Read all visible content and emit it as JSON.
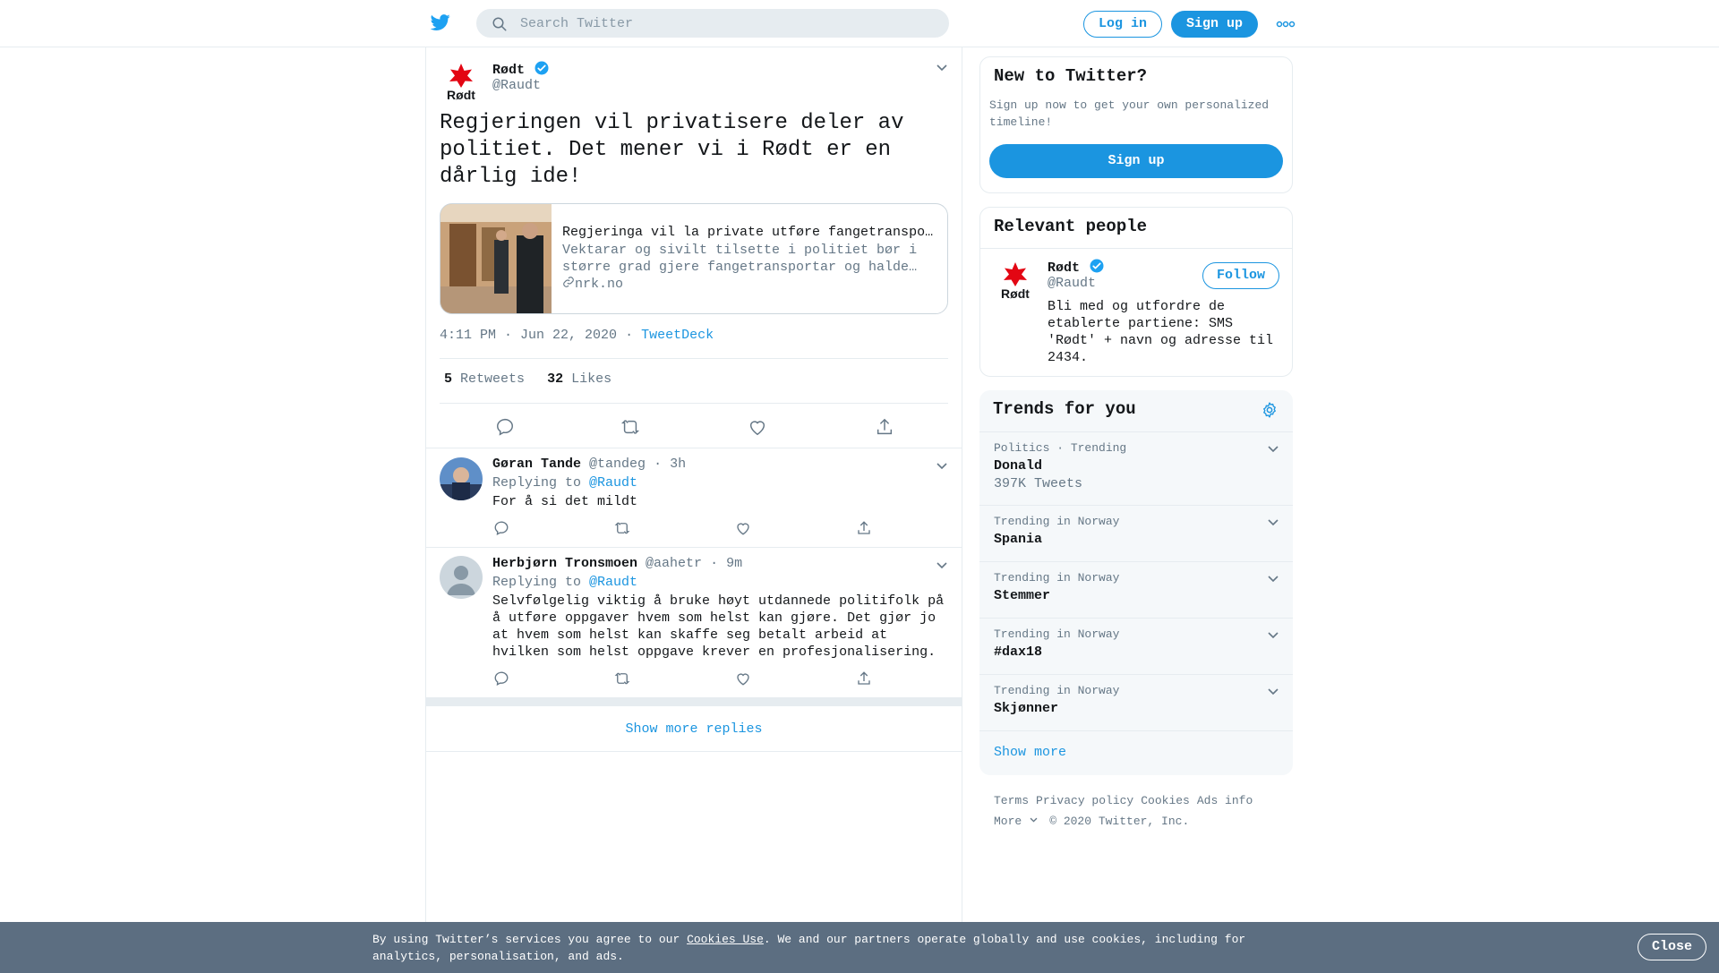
{
  "header": {
    "logo_icon": "twitter-bird-icon",
    "search_placeholder": "Search Twitter",
    "login_label": "Log in",
    "signup_label": "Sign up",
    "more_icon": "more-dots-icon"
  },
  "main_tweet": {
    "author_name": "Rødt",
    "author_handle": "@Raudt",
    "avatar_text": "Rødt",
    "text": "Regjeringen vil privatisere deler av politiet. Det mener vi i Rødt er en dårlig ide!",
    "card": {
      "title": "Regjeringa vil la private utføre fangetransport - NRK Norge",
      "description": "Vektarar og sivilt tilsette i politiet bør i større grad gjere fangetransportar og halde vakt, meiner regjeringa.",
      "domain": "nrk.no"
    },
    "time": "4:11 PM · Jun 22, 2020",
    "separator": "·",
    "source": "TweetDeck",
    "retweets_count": "5",
    "retweets_label": "Retweets",
    "likes_count": "32",
    "likes_label": "Likes"
  },
  "replies": [
    {
      "name": "Gøran Tande",
      "handle": "@tandeg",
      "time": "· 3h",
      "replying_label": "Replying to",
      "replying_to": "@Raudt",
      "text": "For å si det mildt"
    },
    {
      "name": "Herbjørn Tronsmoen",
      "handle": "@aahetr",
      "time": "· 9m",
      "replying_label": "Replying to",
      "replying_to": "@Raudt",
      "text": "Selvfølgelig viktig å bruke høyt utdannede politifolk på å utføre oppgaver hvem som helst kan gjøre. Det gjør jo at hvem som helst kan skaffe seg betalt arbeid at hvilken som helst oppgave krever en profesjonalisering."
    }
  ],
  "show_more_replies": "Show more replies",
  "sidebar": {
    "new_to_twitter": {
      "title": "New to Twitter?",
      "text": "Sign up now to get your own personalized timeline!",
      "button": "Sign up"
    },
    "relevant_people": {
      "title": "Relevant people",
      "name": "Rødt",
      "handle": "@Raudt",
      "follow": "Follow",
      "bio": "Bli med og utfordre de etablerte partiene: SMS 'Rødt' + navn og adresse til 2434."
    },
    "trends": {
      "title": "Trends for you",
      "items": [
        {
          "context": "Politics · Trending",
          "name": "Donald",
          "count": "397K Tweets"
        },
        {
          "context": "Trending in Norway",
          "name": "Spania",
          "count": ""
        },
        {
          "context": "Trending in Norway",
          "name": "Stemmer",
          "count": ""
        },
        {
          "context": "Trending in Norway",
          "name": "#dax18",
          "count": ""
        },
        {
          "context": "Trending in Norway",
          "name": "Skjønner",
          "count": ""
        }
      ],
      "show_more": "Show more"
    },
    "footer": {
      "terms": "Terms",
      "privacy": "Privacy policy",
      "cookies": "Cookies",
      "ads": "Ads info",
      "more": "More",
      "copyright": "© 2020 Twitter, Inc."
    }
  },
  "cookie_bar": {
    "text_before": "By using Twitter’s services you agree to our ",
    "link": "Cookies Use",
    "text_after": ". We and our partners operate globally and use cookies, including for analytics, personalisation, and ads.",
    "close": "Close"
  },
  "colors": {
    "brand_blue": "#1b95e0",
    "border": "#e6ecf0",
    "secondary_text": "#657786",
    "cookie_bar": "#5c6e81",
    "rodt_red": "#e30613"
  }
}
